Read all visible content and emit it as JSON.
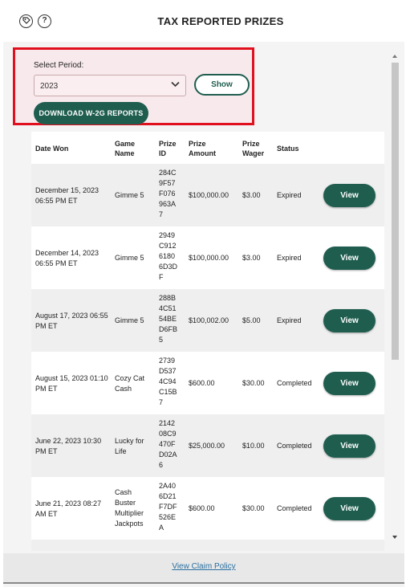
{
  "header": {
    "title": "TAX REPORTED PRIZES",
    "help_glyph": "?",
    "icons": [
      "tag-icon",
      "help-icon"
    ]
  },
  "period": {
    "label": "Select Period:",
    "selected": "2023",
    "show_label": "Show",
    "download_label": "DOWNLOAD W-2G REPORTS"
  },
  "table": {
    "headers": {
      "date_won": "Date Won",
      "game_name": "Game Name",
      "prize_id": "Prize ID",
      "prize_amount": "Prize Amount",
      "prize_wager": "Prize Wager",
      "status": "Status"
    },
    "rows": [
      {
        "date": "December 15, 2023 06:55 PM ET",
        "game": "Gimme 5",
        "prize_id": "284C 9F57 F076 963A 7",
        "amount": "$100,000.00",
        "wager": "$3.00",
        "status": "Expired",
        "action": "View"
      },
      {
        "date": "December 14, 2023 06:55 PM ET",
        "game": "Gimme 5",
        "prize_id": "2949 C912 6180 6D3D F",
        "amount": "$100,000.00",
        "wager": "$3.00",
        "status": "Expired",
        "action": "View"
      },
      {
        "date": "August 17, 2023 06:55 PM ET",
        "game": "Gimme 5",
        "prize_id": "288B 4C51 54BE D6FB 5",
        "amount": "$100,002.00",
        "wager": "$5.00",
        "status": "Expired",
        "action": "View"
      },
      {
        "date": "August 15, 2023 01:10 PM ET",
        "game": "Cozy Cat Cash",
        "prize_id": "2739 D537 4C94 C15B 7",
        "amount": "$600.00",
        "wager": "$30.00",
        "status": "Completed",
        "action": "View"
      },
      {
        "date": "June 22, 2023 10:30 PM ET",
        "game": "Lucky for Life",
        "prize_id": "2142 08C9 470F D02A 6",
        "amount": "$25,000.00",
        "wager": "$10.00",
        "status": "Completed",
        "action": "View"
      },
      {
        "date": "June 21, 2023 08:27 AM ET",
        "game": "Cash Buster Multiplier Jackpots",
        "prize_id": "2A40 6D21 F7DF 526E A",
        "amount": "$600.00",
        "wager": "$30.00",
        "status": "Completed",
        "action": "View"
      }
    ]
  },
  "footer": {
    "claim_policy_label": "View Claim Policy"
  }
}
